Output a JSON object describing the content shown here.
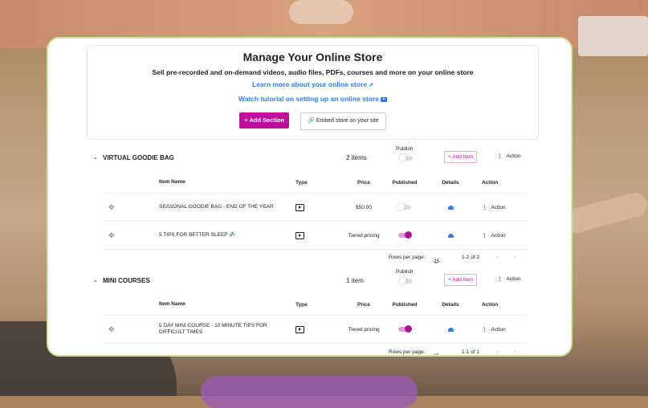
{
  "hero": {
    "title": "Manage Your Online Store",
    "subtitle": "Sell pre-recorded and on-demand videos, audio files, PDFs, courses and more on your online store",
    "learn_more": "Learn more about your online store",
    "tutorial": "Watch tutorial on setting up an online store",
    "add_section": "+ Add Section",
    "embed": "Embed store on your site"
  },
  "columns": {
    "item_name": "Item Name",
    "type": "Type",
    "price": "Price",
    "published": "Published",
    "details": "Details",
    "action": "Action"
  },
  "sections": [
    {
      "name": "VIRTUAL GOODIE BAG",
      "count": "2 items",
      "publish_label": "Publish",
      "publish_on": false,
      "add_item": "+ Add Item",
      "action": "Action",
      "items": [
        {
          "name": "SEASONAL GOODIE BAG - END OF THE YEAR",
          "price": "$50.00",
          "published": false,
          "action": "Action"
        },
        {
          "name": "5 TIPS FOR BETTER SLEEP 💤",
          "price": "Tiered pricing",
          "published": true,
          "action": "Action"
        }
      ],
      "pager": {
        "rows_per_page": "Rows per page:",
        "rows_value": "25",
        "range": "1-2 of 2"
      }
    },
    {
      "name": "MINI COURSES",
      "count": "1 item",
      "publish_label": "Publish",
      "publish_on": false,
      "add_item": "+ Add Item",
      "action": "Action",
      "items": [
        {
          "name": "5 DAY MINI COURSE - 10 MINUTE TIPS FOR DIFFICULT TIMES",
          "price": "Tiered pricing",
          "published": true,
          "action": "Action"
        }
      ],
      "pager": {
        "rows_per_page": "Rows per page:",
        "rows_value": "25",
        "range": "1-1 of 1"
      }
    }
  ],
  "colors": {
    "accent": "#c0119e",
    "link": "#2b7de9",
    "border_highlight": "#cfe59a"
  }
}
